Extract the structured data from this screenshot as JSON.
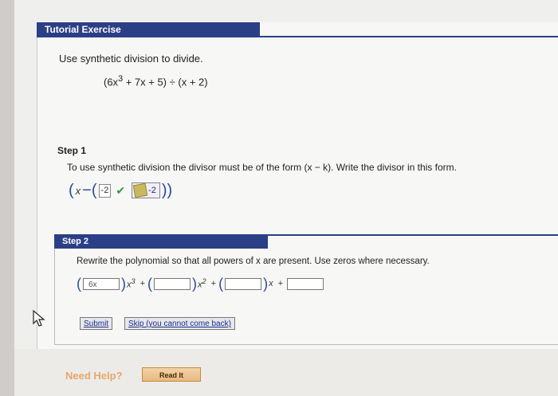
{
  "header": {
    "title": "Tutorial Exercise"
  },
  "problem": {
    "instruction": "Use synthetic division to divide.",
    "expression_pre": "(6x",
    "expression_exp": "3",
    "expression_post": " + 7x + 5) ÷ (x + 2)"
  },
  "step1": {
    "label": "Step 1",
    "text": "To use synthetic division the divisor must be of the form (x − k). Write the divisor in this form.",
    "open": "(",
    "x": "x",
    "minus": "−",
    "open2": "(",
    "answer": "-2",
    "answer2": "-2",
    "close": "))"
  },
  "step2": {
    "label": "Step 2",
    "text": "Rewrite the polynomial so that all powers of x are present. Use zeros where necessary.",
    "coef1": "6x",
    "pow3": "x",
    "exp3": "3",
    "pow2": "x",
    "exp2": "2",
    "pow1": "x",
    "plus": "+"
  },
  "buttons": {
    "submit": "Submit",
    "skip": "Skip (you cannot come back)"
  },
  "help": {
    "need_help": "Need Help?",
    "read_it": "Read It"
  },
  "colors": {
    "header_bg": "#2b3f86",
    "check": "#2e9a36",
    "help_text": "#e6a86a"
  }
}
